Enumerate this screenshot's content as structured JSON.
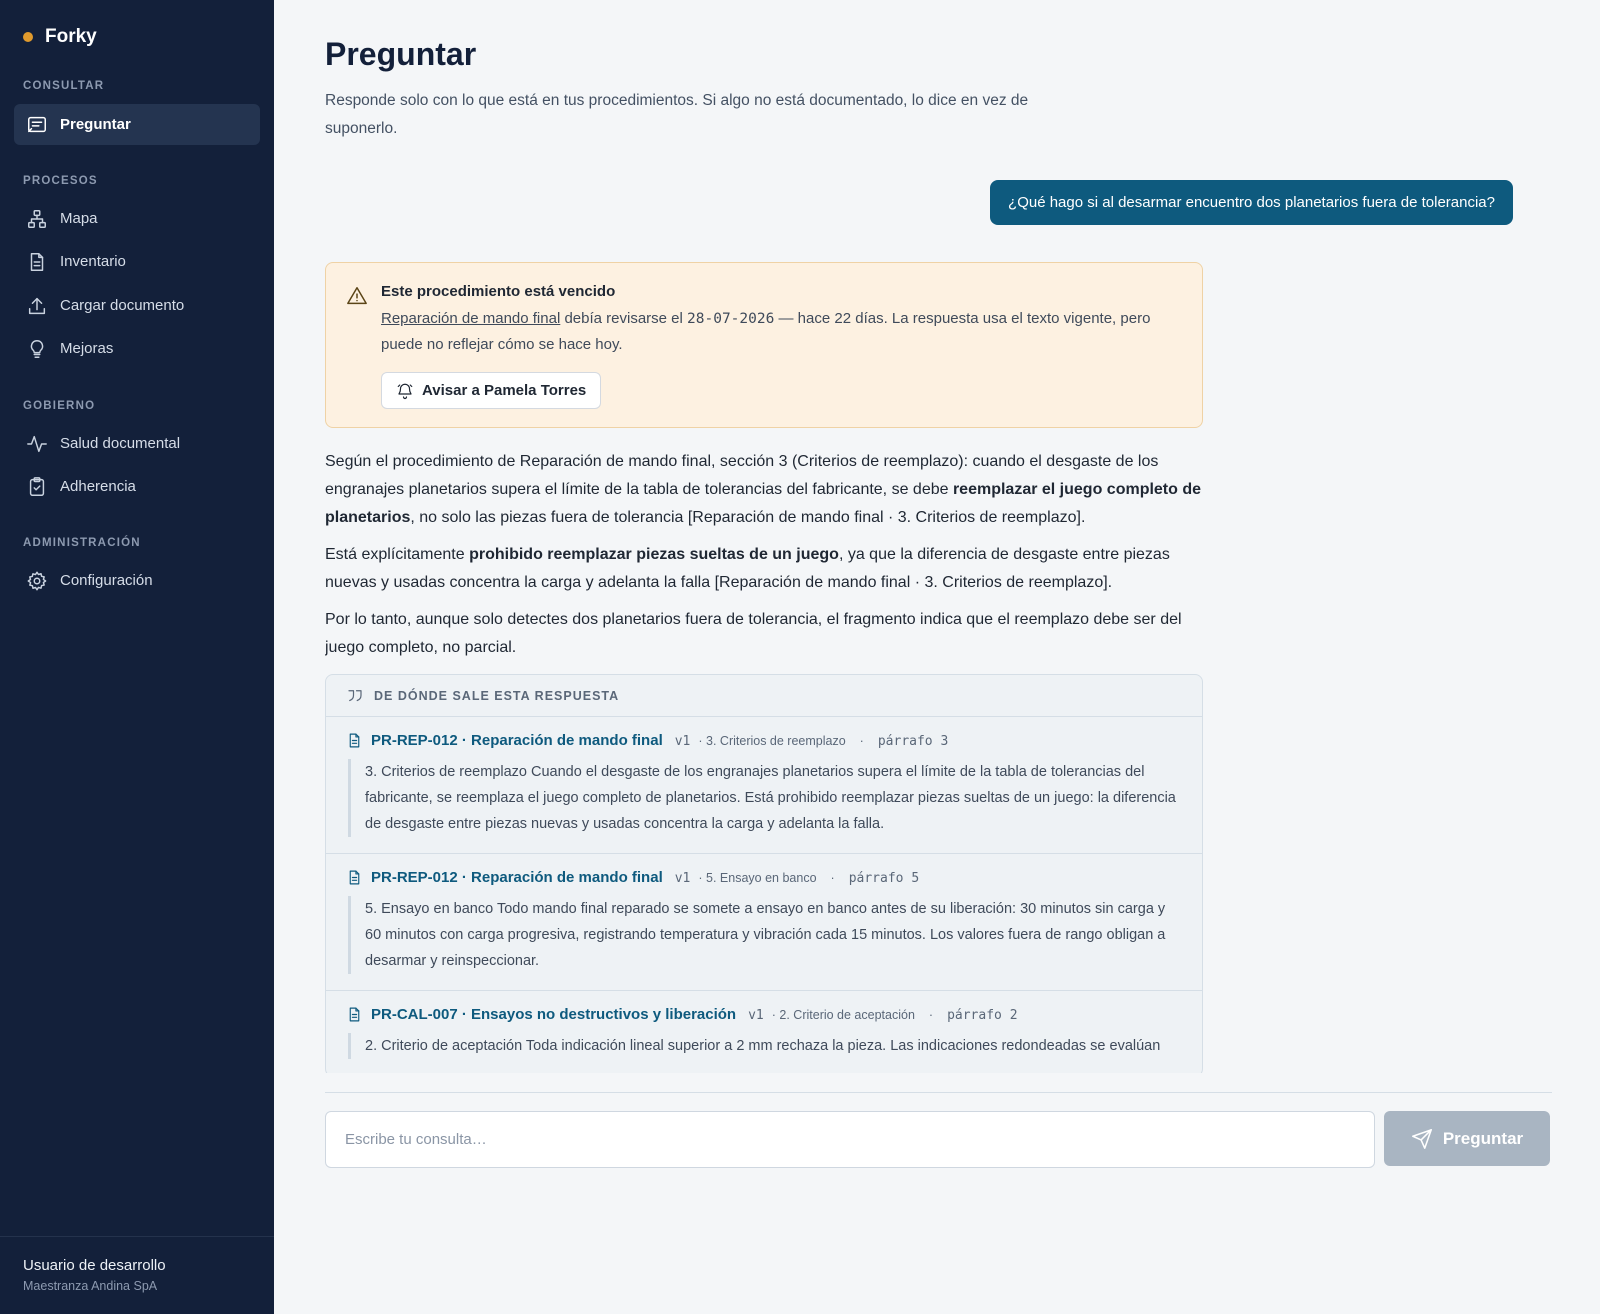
{
  "app": {
    "name": "Forky",
    "accent": "#e09a2d"
  },
  "sidebar": {
    "sections": {
      "consultar": "CONSULTAR",
      "procesos": "PROCESOS",
      "gobierno": "GOBIERNO",
      "administracion": "ADMINISTRACIÓN"
    },
    "items": {
      "preguntar": {
        "label": "Preguntar",
        "icon": "chat-icon",
        "active": true
      },
      "mapa": {
        "label": "Mapa",
        "icon": "sitemap-icon"
      },
      "inventario": {
        "label": "Inventario",
        "icon": "document-icon"
      },
      "cargar": {
        "label": "Cargar documento",
        "icon": "upload-icon"
      },
      "mejoras": {
        "label": "Mejoras",
        "icon": "lightbulb-icon"
      },
      "salud": {
        "label": "Salud documental",
        "icon": "activity-icon"
      },
      "adherencia": {
        "label": "Adherencia",
        "icon": "clipboard-check-icon"
      },
      "configuracion": {
        "label": "Configuración",
        "icon": "gear-icon"
      }
    },
    "footer": {
      "user": "Usuario de desarrollo",
      "org": "Maestranza Andina SpA"
    }
  },
  "main": {
    "title": "Preguntar",
    "subtitle": "Responde solo con lo que está en tus procedimientos. Si algo no está documentado, lo dice en vez de suponerlo.",
    "user_question": "¿Qué hago si al desarmar encuentro dos planetarios fuera de tolerancia?",
    "warning": {
      "title": "Este procedimiento está vencido",
      "link": "Reparación de mando final",
      "text_a": " debía revisarse el ",
      "date": "28-07-2026",
      "text_b": " — hace 22 días. La respuesta usa el texto vigente, pero puede no reflejar cómo se hace hoy.",
      "button": "Avisar a Pamela Torres"
    },
    "answer": {
      "p1_a": "Según el procedimiento de Reparación de mando final, sección 3 (Criterios de reemplazo): cuando el desgaste de los engranajes planetarios supera el límite de la tabla de tolerancias del fabricante, se debe ",
      "p1_b": "reemplazar el juego completo de planetarios",
      "p1_c": ", no solo las piezas fuera de tolerancia [Reparación de mando final · 3. Criterios de reemplazo].",
      "p2_a": "Está explícitamente ",
      "p2_b": "prohibido reemplazar piezas sueltas de un juego",
      "p2_c": ", ya que la diferencia de desgaste entre piezas nuevas y usadas concentra la carga y adelanta la falla [Reparación de mando final · 3. Criterios de reemplazo].",
      "p3": "Por lo tanto, aunque solo detectes dos planetarios fuera de tolerancia, el fragmento indica que el reemplazo debe ser del juego completo, no parcial."
    },
    "sources": {
      "header": "DE DÓNDE SALE ESTA RESPUESTA",
      "items": [
        {
          "title": "PR-REP-012 · Reparación de mando final",
          "version": "v1",
          "section": "· 3. Criterios de reemplazo",
          "sep": "·",
          "paragraph": "párrafo 3",
          "quote": "3. Criterios de reemplazo Cuando el desgaste de los engranajes planetarios supera el límite de la tabla de tolerancias del fabricante, se reemplaza el juego completo de planetarios. Está prohibido reemplazar piezas sueltas de un juego: la diferencia de desgaste entre piezas nuevas y usadas concentra la carga y adelanta la falla."
        },
        {
          "title": "PR-REP-012 · Reparación de mando final",
          "version": "v1",
          "section": "· 5. Ensayo en banco",
          "sep": "·",
          "paragraph": "párrafo 5",
          "quote": "5. Ensayo en banco Todo mando final reparado se somete a ensayo en banco antes de su liberación: 30 minutos sin carga y 60 minutos con carga progresiva, registrando temperatura y vibración cada 15 minutos. Los valores fuera de rango obligan a desarmar y reinspeccionar."
        },
        {
          "title": "PR-CAL-007 · Ensayos no destructivos y liberación",
          "version": "v1",
          "section": "· 2. Criterio de aceptación",
          "sep": "·",
          "paragraph": "párrafo 2",
          "quote": "2. Criterio de aceptación Toda indicación lineal superior a 2 mm rechaza la pieza. Las indicaciones redondeadas se evalúan"
        }
      ]
    },
    "composer": {
      "placeholder": "Escribe tu consulta…",
      "button": "Preguntar"
    }
  }
}
